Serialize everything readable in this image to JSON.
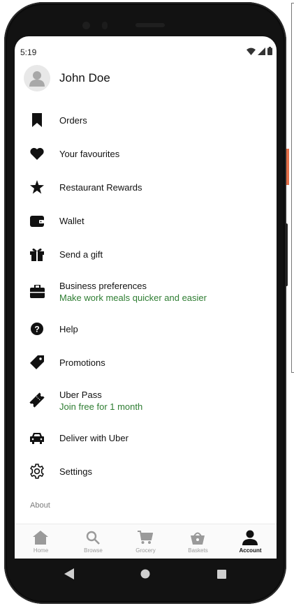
{
  "status_bar": {
    "time": "5:19"
  },
  "profile": {
    "name": "John Doe"
  },
  "menu": [
    {
      "label": "Orders",
      "icon": "bookmark-icon"
    },
    {
      "label": "Your favourites",
      "icon": "heart-icon"
    },
    {
      "label": "Restaurant Rewards",
      "icon": "star-icon"
    },
    {
      "label": "Wallet",
      "icon": "wallet-icon"
    },
    {
      "label": "Send a gift",
      "icon": "gift-icon"
    },
    {
      "label": "Business preferences",
      "subtitle": "Make work meals quicker and easier",
      "icon": "briefcase-icon"
    },
    {
      "label": "Help",
      "icon": "help-icon"
    },
    {
      "label": "Promotions",
      "icon": "tag-icon"
    },
    {
      "label": "Uber Pass",
      "subtitle": "Join free for 1 month",
      "icon": "ticket-icon"
    },
    {
      "label": "Deliver with Uber",
      "icon": "car-icon"
    },
    {
      "label": "Settings",
      "icon": "gear-icon"
    }
  ],
  "about": {
    "label": "About"
  },
  "tabs": [
    {
      "label": "Home",
      "icon": "home-icon"
    },
    {
      "label": "Browse",
      "icon": "search-icon"
    },
    {
      "label": "Grocery",
      "icon": "cart-icon"
    },
    {
      "label": "Baskets",
      "icon": "basket-icon"
    },
    {
      "label": "Account",
      "icon": "person-icon",
      "active": true
    }
  ],
  "colors": {
    "accent_green": "#2e7d32",
    "active_tab": "#111111",
    "inactive_tab": "#9a9a9a"
  }
}
